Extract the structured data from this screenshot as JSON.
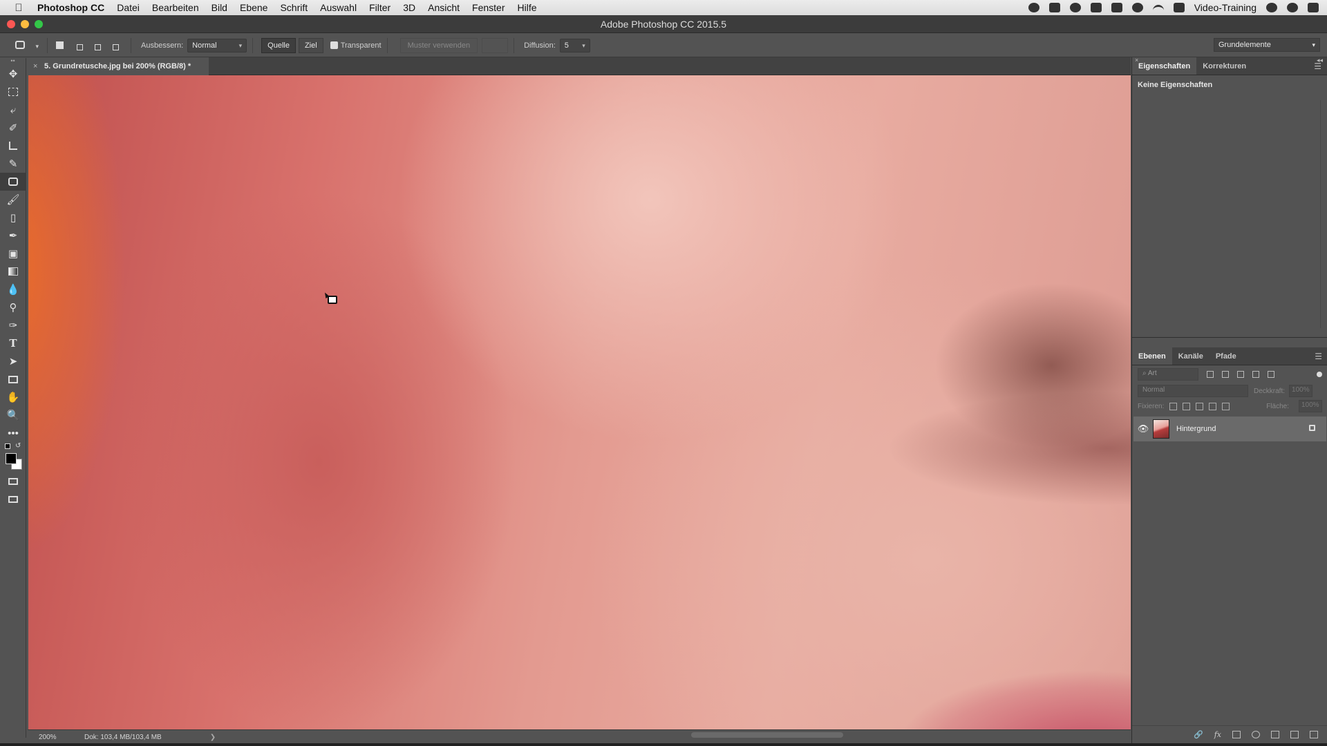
{
  "menubar": {
    "app_name": "Photoshop CC",
    "items": [
      "Datei",
      "Bearbeiten",
      "Bild",
      "Ebene",
      "Schrift",
      "Auswahl",
      "Filter",
      "3D",
      "Ansicht",
      "Fenster",
      "Hilfe"
    ],
    "user": "Video-Training"
  },
  "window": {
    "title": "Adobe Photoshop CC 2015.5"
  },
  "options": {
    "ausbessern_label": "Ausbessern:",
    "ausbessern_value": "Normal",
    "quelle_label": "Quelle",
    "ziel_label": "Ziel",
    "transparent_label": "Transparent",
    "muster_label": "Muster verwenden",
    "diffusion_label": "Diffusion:",
    "diffusion_value": "5",
    "workspace_value": "Grundelemente"
  },
  "toolbar": {
    "active_tool": "patch-tool",
    "foreground_color": "#000000",
    "background_color": "#ffffff"
  },
  "document": {
    "tab_title": "5. Grundretusche.jpg bei 200% (RGB/8) *",
    "zoom": "200%",
    "doc_size": "Dok: 103,4 MB/103,4 MB"
  },
  "properties": {
    "tabs": [
      "Eigenschaften",
      "Korrekturen"
    ],
    "empty_text": "Keine Eigenschaften"
  },
  "layers": {
    "tabs": [
      "Ebenen",
      "Kanäle",
      "Pfade"
    ],
    "filter_placeholder": "Art",
    "blend_mode": "Normal",
    "opacity_label": "Deckkraft:",
    "opacity_value": "100%",
    "lock_label": "Fixieren:",
    "fill_label": "Fläche:",
    "fill_value": "100%",
    "items": [
      {
        "name": "Hintergrund",
        "visible": true,
        "locked": true
      }
    ]
  }
}
